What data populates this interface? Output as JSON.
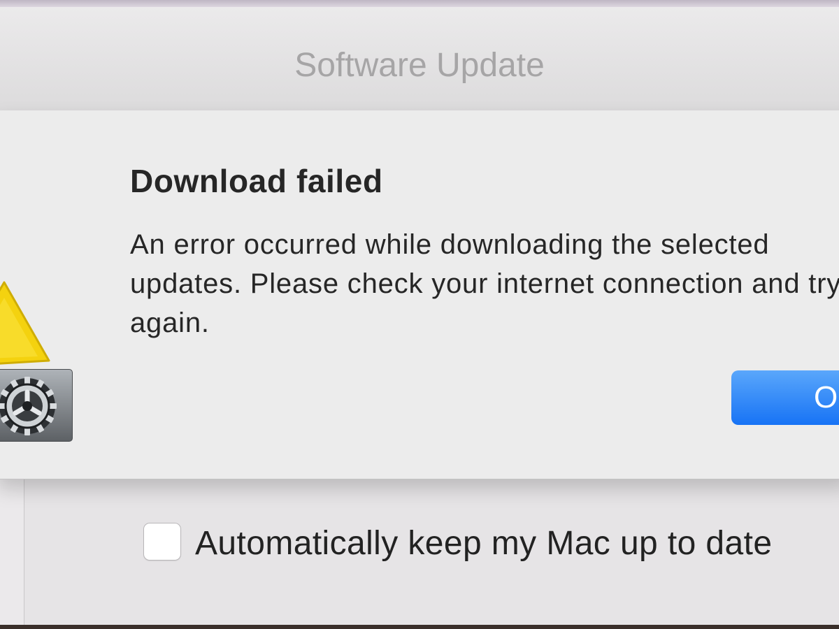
{
  "window": {
    "title": "Software Update",
    "auto_update_label": "Automatically keep my Mac up to date",
    "auto_update_checked": false
  },
  "alert": {
    "title": "Download failed",
    "message": "An error occurred while downloading the selected updates. Please check your internet connection and try again.",
    "ok_label": "OK",
    "icon": "warning-triangle-icon",
    "badge_icon": "system-preferences-gear-icon"
  },
  "colors": {
    "accent": "#1a74f5",
    "warning": "#f5d40c"
  }
}
